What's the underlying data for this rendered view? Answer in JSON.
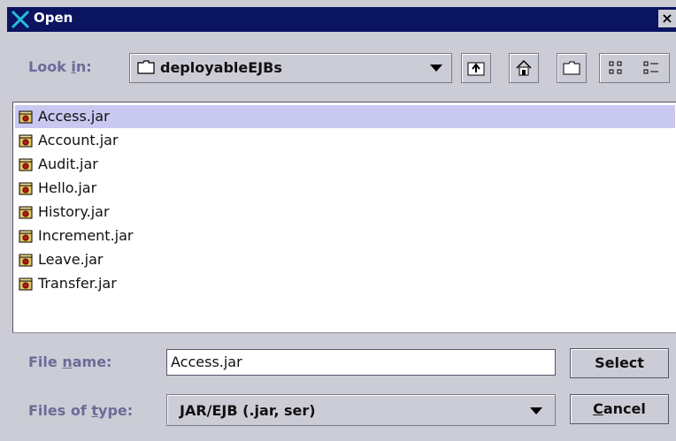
{
  "window": {
    "title": "Open",
    "close_label": "×"
  },
  "lookin": {
    "label_pre": "Look ",
    "label_mnemonic": "i",
    "label_post": "n:",
    "value": "deployableEJBs"
  },
  "toolbar": {
    "up_folder": "up-one-level-icon",
    "home": "home-icon",
    "new_folder": "new-folder-icon",
    "list_view": "list-view-icon",
    "details_view": "details-view-icon"
  },
  "files": [
    {
      "name": "Access.jar",
      "selected": true
    },
    {
      "name": "Account.jar"
    },
    {
      "name": "Audit.jar"
    },
    {
      "name": "Hello.jar"
    },
    {
      "name": "History.jar"
    },
    {
      "name": "Increment.jar"
    },
    {
      "name": "Leave.jar"
    },
    {
      "name": "Transfer.jar"
    }
  ],
  "filename": {
    "label_pre": "File ",
    "label_mnemonic": "n",
    "label_post": "ame:",
    "value": "Access.jar"
  },
  "filetype": {
    "label_pre": "Files of ",
    "label_mnemonic": "t",
    "label_post": "ype:",
    "value": "JAR/EJB (.jar, ser)"
  },
  "buttons": {
    "select": "Select",
    "cancel_mnemonic": "C",
    "cancel_rest": "ancel"
  },
  "colors": {
    "title_bar": "#0b1460",
    "label": "#6b6b9a",
    "selection": "#c8c8f0",
    "background": "#ccccd6"
  }
}
